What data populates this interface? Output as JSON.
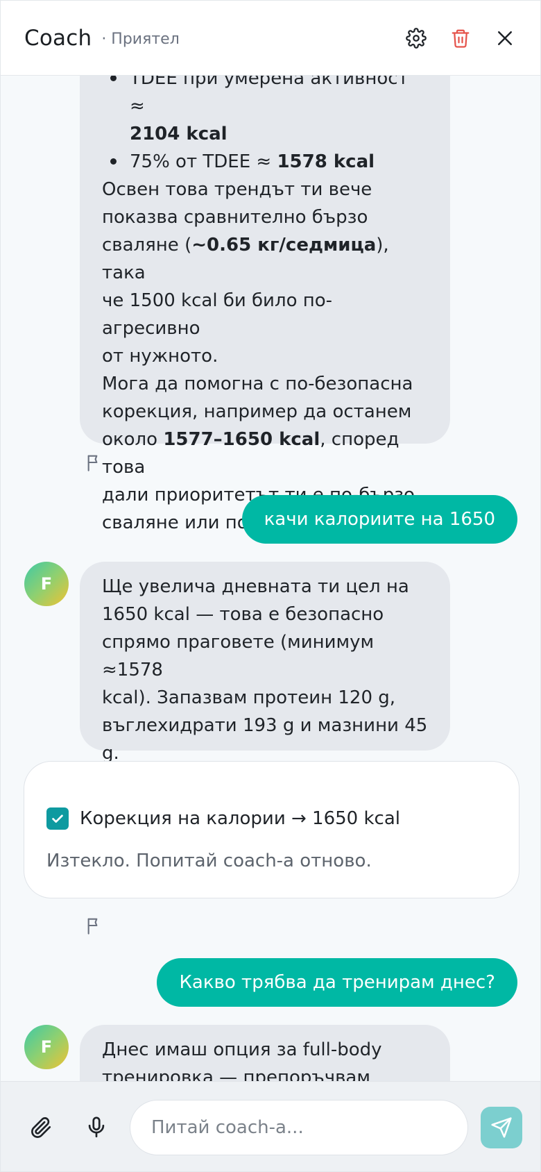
{
  "header": {
    "title": "Coach",
    "subtitle": "· Приятел"
  },
  "messages": {
    "ai1": {
      "bullet1_a": "TDEE при умерена активност ≈",
      "bullet1_b": "2104 kcal",
      "bullet2_a": "75% от TDEE ≈ ",
      "bullet2_b": "1578 kcal",
      "p1_a": "Освен това трендът ти вече",
      "p1_b": "показва сравнително бързо",
      "p1_c_pre": "сваляне (",
      "p1_c_bold": "~0.65 кг/седмица",
      "p1_c_post": "), така",
      "p1_d": "че 1500 kcal би било по-агресивно",
      "p1_e": "от нужното.",
      "p2_a": "Мога да помогна с по-безопасна",
      "p2_b": "корекция, например да останем",
      "p2_c_pre": "около ",
      "p2_c_bold": "1577–1650 kcal",
      "p2_c_post": ", според това",
      "p2_d": "дали приоритетът ти е по-бързо",
      "p2_e": "сваляне или повече енергия."
    },
    "user1": "качи калориите на 1650",
    "avatar_letter": "F",
    "ai2": {
      "l1": "Ще увелича дневната ти цел на",
      "l2": "1650 kcal — това е безопасно",
      "l3": "спрямо праговете (минимум ≈1578",
      "l4": "kcal). Запазвам протеин 120 g,",
      "l5": "въглехидрати 193 g и мазнини 45",
      "l6": "g."
    },
    "action_card": {
      "label": "Корекция на калории → 1650 kcal",
      "note": "Изтекло. Попитай coach-а отново."
    },
    "user2": "Какво трябва да тренирам днес?",
    "ai3": {
      "l1": "Днес имаш опция за full-body",
      "l2": "тренировка — препоръчвам"
    }
  },
  "composer": {
    "placeholder": "Питай coach-а..."
  },
  "colors": {
    "accent": "#00b8a4",
    "danger": "#e5534b",
    "send": "#7ccfcf",
    "bubble_ai": "#e5e8ed"
  },
  "icons": {
    "settings": "gear-icon",
    "delete": "trash-icon",
    "close": "close-icon",
    "flag": "flag-icon",
    "attach": "paperclip-icon",
    "mic": "microphone-icon",
    "send": "send-icon",
    "check": "checkmark-icon"
  }
}
